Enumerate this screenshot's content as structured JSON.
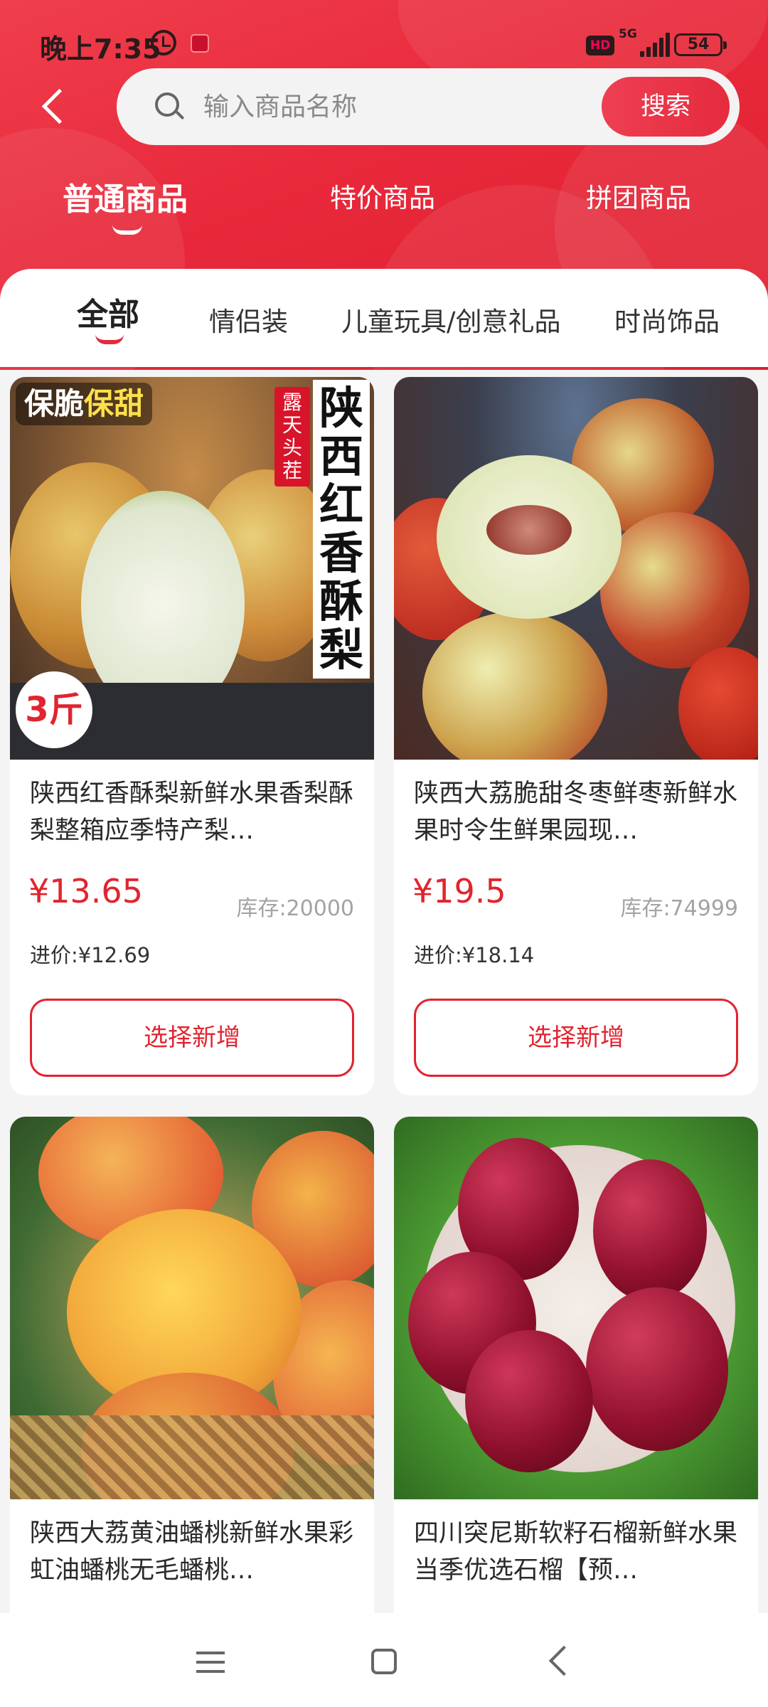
{
  "status_bar": {
    "time": "晚上7:35",
    "hd": "HD",
    "network": "5G",
    "battery": "54"
  },
  "search": {
    "placeholder": "输入商品名称",
    "button_label": "搜索"
  },
  "type_tabs": [
    {
      "label": "普通商品",
      "active": true
    },
    {
      "label": "特价商品",
      "active": false
    },
    {
      "label": "拼团商品",
      "active": false
    }
  ],
  "categories": [
    {
      "label": "全部",
      "active": true
    },
    {
      "label": "情侣装",
      "active": false
    },
    {
      "label": "儿童玩具/创意礼品",
      "active": false
    },
    {
      "label": "时尚饰品",
      "active": false
    }
  ],
  "products": [
    {
      "title": "陕西红香酥梨新鲜水果香梨酥梨整箱应季特产梨…",
      "price": "¥13.65",
      "stock": "库存:20000",
      "cost": "进价:¥12.69",
      "button": "选择新增",
      "image_badges": {
        "top_left_a": "保脆",
        "top_left_b": "保甜",
        "weight": "3斤",
        "vertical_title": "陕西红香酥梨",
        "seal": "露天头茬"
      }
    },
    {
      "title": "陕西大荔脆甜冬枣鲜枣新鲜水果时令生鲜果园现…",
      "price": "¥19.5",
      "stock": "库存:74999",
      "cost": "进价:¥18.14",
      "button": "选择新增"
    },
    {
      "title": "陕西大荔黄油蟠桃新鲜水果彩虹油蟠桃无毛蟠桃…"
    },
    {
      "title": "四川突尼斯软籽石榴新鲜水果当季优选石榴【预…"
    }
  ],
  "colors": {
    "brand_red": "#e32b3c",
    "price_red": "#e1242f"
  }
}
